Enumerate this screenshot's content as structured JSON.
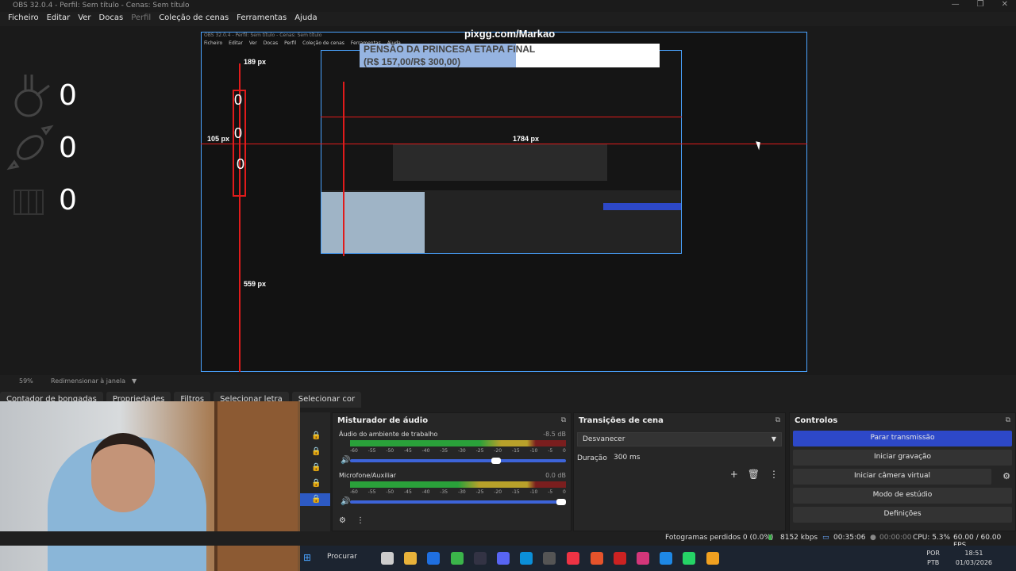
{
  "window": {
    "title": "OBS 32.0.4 - Perfil: Sem título - Cenas: Sem título"
  },
  "menu": {
    "items": [
      "Ficheiro",
      "Editar",
      "Ver",
      "Docas",
      "Perfil",
      "Coleção de cenas",
      "Ferramentas",
      "Ajuda"
    ]
  },
  "overlay": {
    "watermark": "pixgg.com/Markao",
    "banner_line1": "PENSÃO DA PRINCESA ETAPA FINAL",
    "banner_line2": "(R$ 157,00/R$ 300,00)",
    "counters": [
      {
        "icon": "flask-icon",
        "value": "0"
      },
      {
        "icon": "candy-icon",
        "value": "0"
      },
      {
        "icon": "cage-icon",
        "value": "0"
      }
    ],
    "measures": {
      "top": "189 px",
      "left": "105 px",
      "right": "1784 px",
      "bottom": "559 px"
    }
  },
  "zoombar": {
    "zoom": "59%",
    "label": "Redimensionar à janela"
  },
  "docktabs": [
    "Contador de bongadas",
    "Propriedades",
    "Filtros",
    "Selecionar letra",
    "Selecionar cor"
  ],
  "mixer": {
    "title": "Misturador de áudio",
    "tracks": [
      {
        "name": "Áudio do ambiente de trabalho",
        "db": "-8.5 dB",
        "level": 0.8
      },
      {
        "name": "Microfone/Auxiliar",
        "db": "0.0 dB",
        "level": 1.0
      }
    ],
    "ticks": [
      "-60",
      "-55",
      "-50",
      "-45",
      "-40",
      "-35",
      "-30",
      "-25",
      "-20",
      "-15",
      "-10",
      "-5",
      "0"
    ]
  },
  "transitions": {
    "title": "Transições de cena",
    "selected": "Desvanecer",
    "duration_label": "Duração",
    "duration_value": "300 ms"
  },
  "controls": {
    "title": "Controlos",
    "buttons": [
      "Parar transmissão",
      "Iniciar gravação",
      "Iniciar câmera virtual",
      "Modo de estúdio",
      "Definições"
    ]
  },
  "status": {
    "frames": "Fotogramas perdidos 0 (0.0%)",
    "bitrate": "8152 kbps",
    "stream_time": "00:35:06",
    "rec_time": "00:00:00",
    "cpu": "CPU: 5.3%",
    "fps": "60.00 / 60.00 FPS"
  },
  "taskbar": {
    "search": "Procurar",
    "lang1": "POR",
    "lang2": "PTB",
    "time": "18:51",
    "date": "01/03/2026"
  }
}
